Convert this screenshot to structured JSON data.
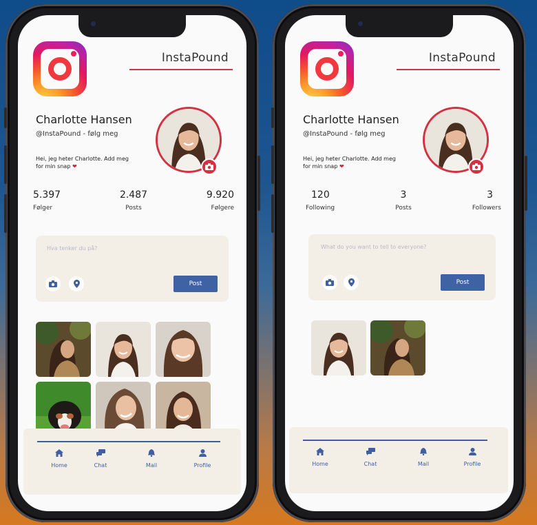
{
  "colors": {
    "accent_red": "#d33242",
    "nav_blue": "#3f5fa0",
    "post_button": "#3f62a4",
    "card_bg": "#f3efe6"
  },
  "phones": [
    {
      "app_title": "InstaPound",
      "name": "Charlotte Hansen",
      "handle": "@InstaPound - følg meg",
      "bio": "Hei, jeg heter Charlotte. Add meg for min snap",
      "stats": [
        {
          "value": "5.397",
          "label": "Følger"
        },
        {
          "value": "2.487",
          "label": "Posts"
        },
        {
          "value": "9.920",
          "label": "Følgere"
        }
      ],
      "composer_placeholder": "Hva tenker du på?",
      "post_label": "Post",
      "gallery_icons": [
        "photo-woman-autumn",
        "photo-woman-smile",
        "photo-woman-portrait",
        "photo-dog",
        "photo-woman-laugh",
        "photo-woman-brown"
      ],
      "nav": [
        {
          "icon": "home-icon",
          "label": "Home"
        },
        {
          "icon": "chat-icon",
          "label": "Chat"
        },
        {
          "icon": "bell-icon",
          "label": "Mail"
        },
        {
          "icon": "user-icon",
          "label": "Profile"
        }
      ]
    },
    {
      "app_title": "InstaPound",
      "name": "Charlotte Hansen",
      "handle": "@InstaPound - følg meg",
      "bio": "Hei, jeg heter Charlotte. Add meg for min snap",
      "stats": [
        {
          "value": "120",
          "label": "Following"
        },
        {
          "value": "3",
          "label": "Posts"
        },
        {
          "value": "3",
          "label": "Followers"
        }
      ],
      "composer_placeholder": "What do you want to tell to everyone?",
      "post_label": "Post",
      "gallery_icons": [
        "photo-woman-smile",
        "photo-woman-autumn"
      ],
      "nav": [
        {
          "icon": "home-icon",
          "label": "Home"
        },
        {
          "icon": "chat-icon",
          "label": "Chat"
        },
        {
          "icon": "bell-icon",
          "label": "Mail"
        },
        {
          "icon": "user-icon",
          "label": "Profile"
        }
      ]
    }
  ]
}
